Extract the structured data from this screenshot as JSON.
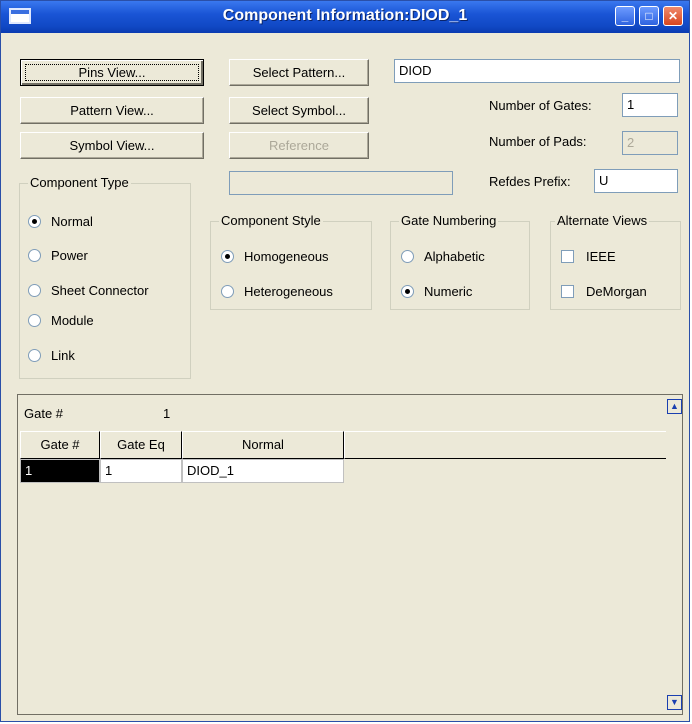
{
  "window": {
    "title": "Component Information:DIOD_1"
  },
  "titlebar_buttons": {
    "minimize": "_",
    "maximize": "□",
    "close": "✕"
  },
  "buttons": {
    "pins_view": "Pins View...",
    "pattern_view": "Pattern View...",
    "symbol_view": "Symbol View...",
    "select_pattern": "Select Pattern...",
    "select_symbol": "Select Symbol...",
    "reference": "Reference"
  },
  "fields": {
    "component_name": "DIOD",
    "blank_field": "",
    "number_of_gates_label": "Number of Gates:",
    "number_of_gates": "1",
    "number_of_pads_label": "Number of Pads:",
    "number_of_pads": "2",
    "refdes_prefix_label": "Refdes Prefix:",
    "refdes_prefix": "U"
  },
  "component_type": {
    "title": "Component Type",
    "options": [
      {
        "label": "Normal",
        "selected": true
      },
      {
        "label": "Power",
        "selected": false
      },
      {
        "label": "Sheet Connector",
        "selected": false
      },
      {
        "label": "Module",
        "selected": false
      },
      {
        "label": "Link",
        "selected": false
      }
    ]
  },
  "component_style": {
    "title": "Component Style",
    "options": [
      {
        "label": "Homogeneous",
        "selected": true
      },
      {
        "label": "Heterogeneous",
        "selected": false
      }
    ]
  },
  "gate_numbering": {
    "title": "Gate Numbering",
    "options": [
      {
        "label": "Alphabetic",
        "selected": false
      },
      {
        "label": "Numeric",
        "selected": true
      }
    ]
  },
  "alternate_views": {
    "title": "Alternate Views",
    "options": [
      {
        "label": "IEEE",
        "checked": false
      },
      {
        "label": "DeMorgan",
        "checked": false
      }
    ]
  },
  "gate_panel": {
    "gate_label": "Gate #",
    "gate_value": "1",
    "columns": [
      "Gate #",
      "Gate Eq",
      "Normal"
    ],
    "rows": [
      [
        "1",
        "1",
        "DIOD_1"
      ]
    ]
  },
  "scroll_icons": {
    "up": "up-arrow-icon",
    "down": "down-arrow-icon"
  },
  "colors": {
    "titlebar": "#1a55d6",
    "face": "#ece9d8",
    "selection": "#000000"
  }
}
